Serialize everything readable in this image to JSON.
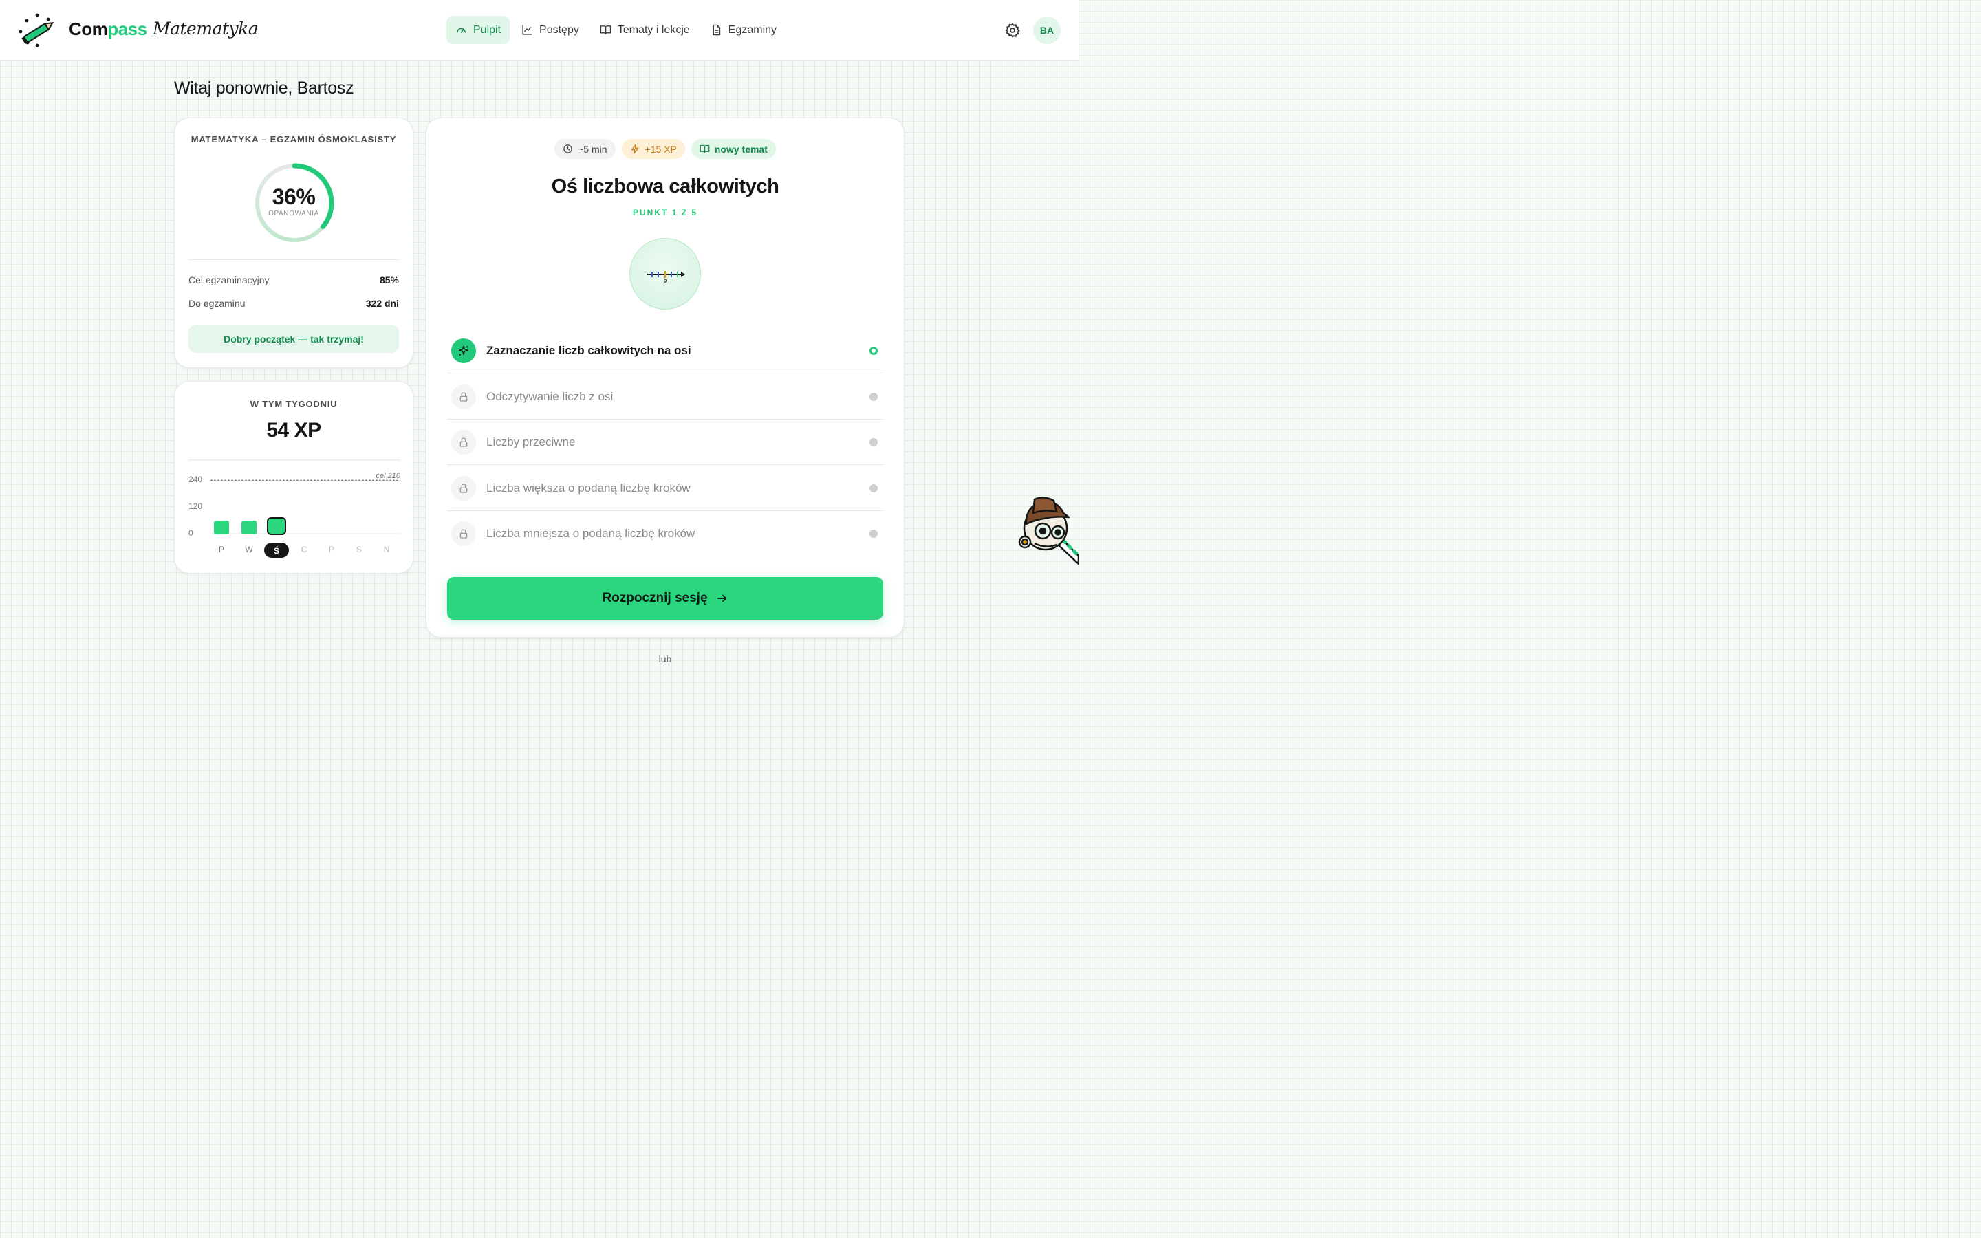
{
  "header": {
    "brand_part1": "Com",
    "brand_part2": "pass",
    "brand_subtitle": "Matematyka",
    "nav": [
      {
        "label": "Pulpit",
        "icon": "gauge-icon",
        "active": true
      },
      {
        "label": "Postępy",
        "icon": "line-chart-icon",
        "active": false
      },
      {
        "label": "Tematy i lekcje",
        "icon": "book-icon",
        "active": false
      },
      {
        "label": "Egzaminy",
        "icon": "document-icon",
        "active": false
      }
    ],
    "settings_icon": "gear-icon",
    "avatar_initials": "BA"
  },
  "welcome": "Witaj ponownie, Bartosz",
  "mastery_card": {
    "title": "MATEMATYKA – EGZAMIN ÓSMOKLASISTY",
    "percent_label": "36%",
    "percent_value": 0.36,
    "percent_caption": "OPANOWANIA",
    "exam_target_label": "Cel egzaminacyjny",
    "exam_target_value": "85%",
    "days_label": "Do egzaminu",
    "days_value": "322 dni",
    "encouragement": "Dobry początek — tak trzymaj!"
  },
  "week_card": {
    "title": "W TYM TYGODNIU",
    "xp": "54 XP",
    "goal_label": "cel 210",
    "chart_data": {
      "type": "bar",
      "categories": [
        "P",
        "W",
        "Ś",
        "C",
        "P",
        "S",
        "N"
      ],
      "values": [
        20,
        20,
        14,
        0,
        0,
        0,
        0
      ],
      "ylim": [
        0,
        240
      ],
      "yticks": [
        "240",
        "120",
        "0"
      ],
      "goal": 210,
      "highlight_index": 2
    }
  },
  "lesson_card": {
    "pill_time": "~5 min",
    "pill_xp": "+15 XP",
    "pill_new": "nowy temat",
    "title": "Oś liczbowa całkowitych",
    "subtitle": "PUNKT 1 Z 5",
    "topic_icon": "number-line-icon",
    "lessons": [
      {
        "label": "Zaznaczanie liczb całkowitych na osi",
        "state": "active"
      },
      {
        "label": "Odczytywanie liczb z osi",
        "state": "locked"
      },
      {
        "label": "Liczby przeciwne",
        "state": "locked"
      },
      {
        "label": "Liczba większa o podaną liczbę kroków",
        "state": "locked"
      },
      {
        "label": "Liczba mniejsza o podaną liczbę kroków",
        "state": "locked"
      }
    ],
    "start_button": "Rozpocznij sesję",
    "or_text": "lub"
  },
  "colors": {
    "accent": "#22c97a",
    "accent_dark": "#13894d",
    "accent_light": "#e3f6ea",
    "xp_orange": "#c77d12"
  }
}
